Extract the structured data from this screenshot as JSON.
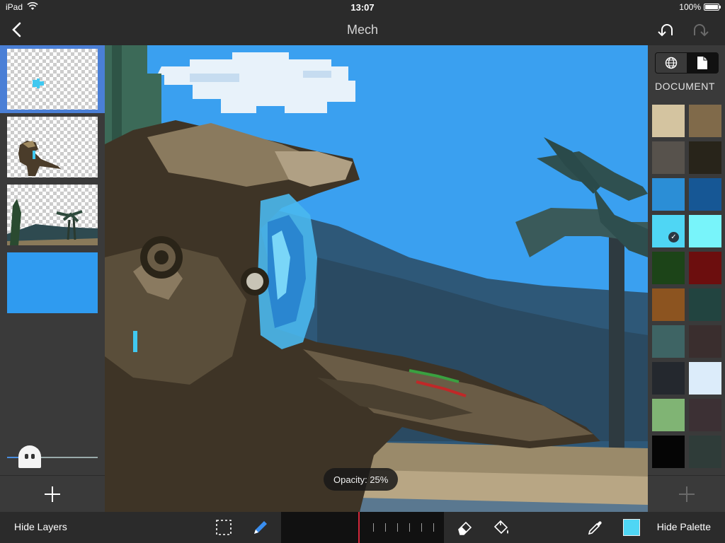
{
  "status_bar": {
    "device": "iPad",
    "time": "13:07",
    "battery": "100%",
    "battery_level": 1.0
  },
  "nav": {
    "title": "Mech",
    "back_icon": "chevron-left-icon",
    "undo_icon": "undo-icon",
    "redo_icon": "redo-icon"
  },
  "layers": {
    "items": [
      {
        "name": "layer-1",
        "selected": true
      },
      {
        "name": "layer-2",
        "selected": false
      },
      {
        "name": "layer-3",
        "selected": false
      },
      {
        "name": "layer-4",
        "selected": false
      }
    ],
    "opacity_level": 0.25,
    "opacity_icon": "ghost-icon",
    "add_icon": "plus-icon"
  },
  "canvas": {
    "opacity_toast": "Opacity: 25%"
  },
  "palette": {
    "segments": [
      "globe-icon",
      "document-icon"
    ],
    "active_segment": "document-icon",
    "label": "DOCUMENT",
    "colors": [
      "#d4c4a0",
      "#806a4a",
      "#57524c",
      "#28241a",
      "#2b8ed6",
      "#165795",
      "#4fd6f4",
      "#78f4fa",
      "#1c4418",
      "#6c0e0e",
      "#8c5420",
      "#224440",
      "#3e6464",
      "#3a2e2e",
      "#24282e",
      "#dcecfa",
      "#80b474",
      "#3c3034",
      "#050505",
      "#2f3c39"
    ],
    "selected_color_index": 6,
    "add_icon": "plus-icon"
  },
  "toolbar": {
    "hide_layers": "Hide Layers",
    "hide_palette": "Hide Palette",
    "current_color": "#4fd6f4"
  }
}
